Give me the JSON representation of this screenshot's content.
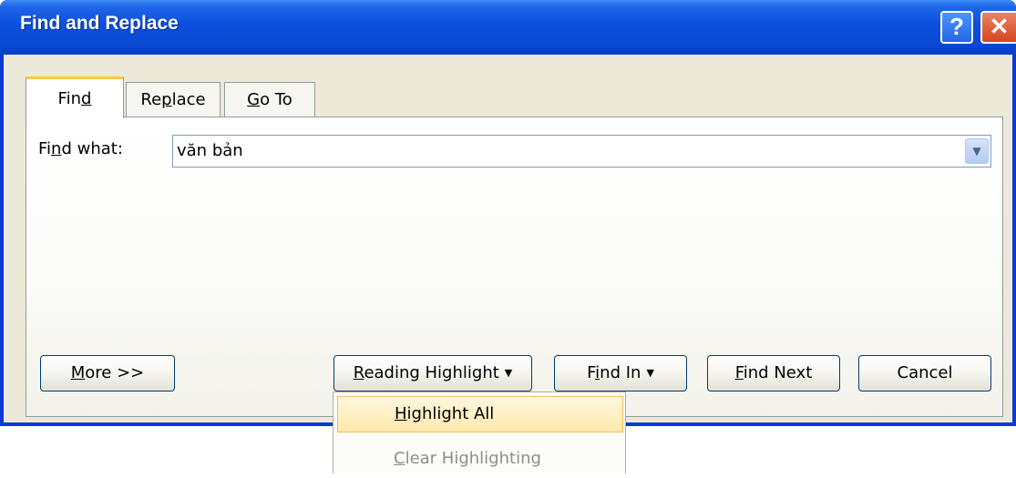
{
  "window": {
    "title": "Find and Replace",
    "help_glyph": "?",
    "close_glyph": "✕"
  },
  "tabs": [
    {
      "label": "Find",
      "accel_index": 3,
      "selected": true
    },
    {
      "label": "Replace",
      "accel_index": 3,
      "selected": false
    },
    {
      "label": "Go To",
      "accel_index": 0,
      "selected": false
    }
  ],
  "find": {
    "label": "Find what:",
    "value": "văn bản"
  },
  "buttons": {
    "more": "More >>",
    "reading_highlight": "Reading Highlight",
    "find_in": "Find In",
    "find_next": "Find Next",
    "cancel": "Cancel"
  },
  "menu": {
    "items": [
      {
        "label": "Highlight All",
        "enabled": true,
        "hovered": true
      },
      {
        "label": "Clear Highlighting",
        "enabled": false,
        "hovered": false
      }
    ]
  },
  "colors": {
    "titlebar": "#0b4fdc",
    "dialog_bg": "#ece9d8",
    "menu_hover": "#ffe9ad"
  }
}
